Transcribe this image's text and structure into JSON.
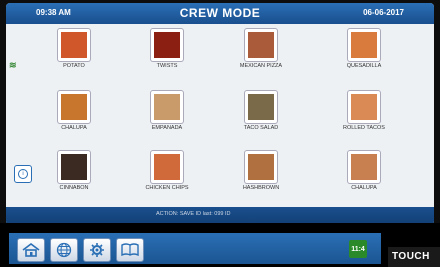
{
  "header": {
    "time": "09:38 AM",
    "title": "CREW MODE",
    "date": "06-06-2017"
  },
  "items": [
    {
      "label": "POTATO",
      "color": "#d0572a"
    },
    {
      "label": "TWISTS",
      "color": "#8a1f12"
    },
    {
      "label": "MEXICAN PIZZA",
      "color": "#a95b3a"
    },
    {
      "label": "QUESADILLA",
      "color": "#d87b3d"
    },
    {
      "label": "CHALUPA",
      "color": "#c8762e"
    },
    {
      "label": "EMPANADA",
      "color": "#c99a6a"
    },
    {
      "label": "TACO SALAD",
      "color": "#7a6a4a"
    },
    {
      "label": "ROLLED TACOS",
      "color": "#d98a55"
    },
    {
      "label": "CINNABON",
      "color": "#3a2a22"
    },
    {
      "label": "CHICKEN CHIPS",
      "color": "#d06a3a"
    },
    {
      "label": "HASHBROWN",
      "color": "#b07040"
    },
    {
      "label": "CHALUPA",
      "color": "#c98050"
    }
  ],
  "status": {
    "text": "ACTION: SAVE ID  last: 099 ID"
  },
  "nav": {
    "home": "home-icon",
    "globe": "globe-icon",
    "settings": "settings-icon",
    "book": "book-icon",
    "counter": "11:4"
  },
  "touch_label": "TOUCH",
  "colors": {
    "accent": "#1a4f8e",
    "counter": "#2a8a2a"
  }
}
